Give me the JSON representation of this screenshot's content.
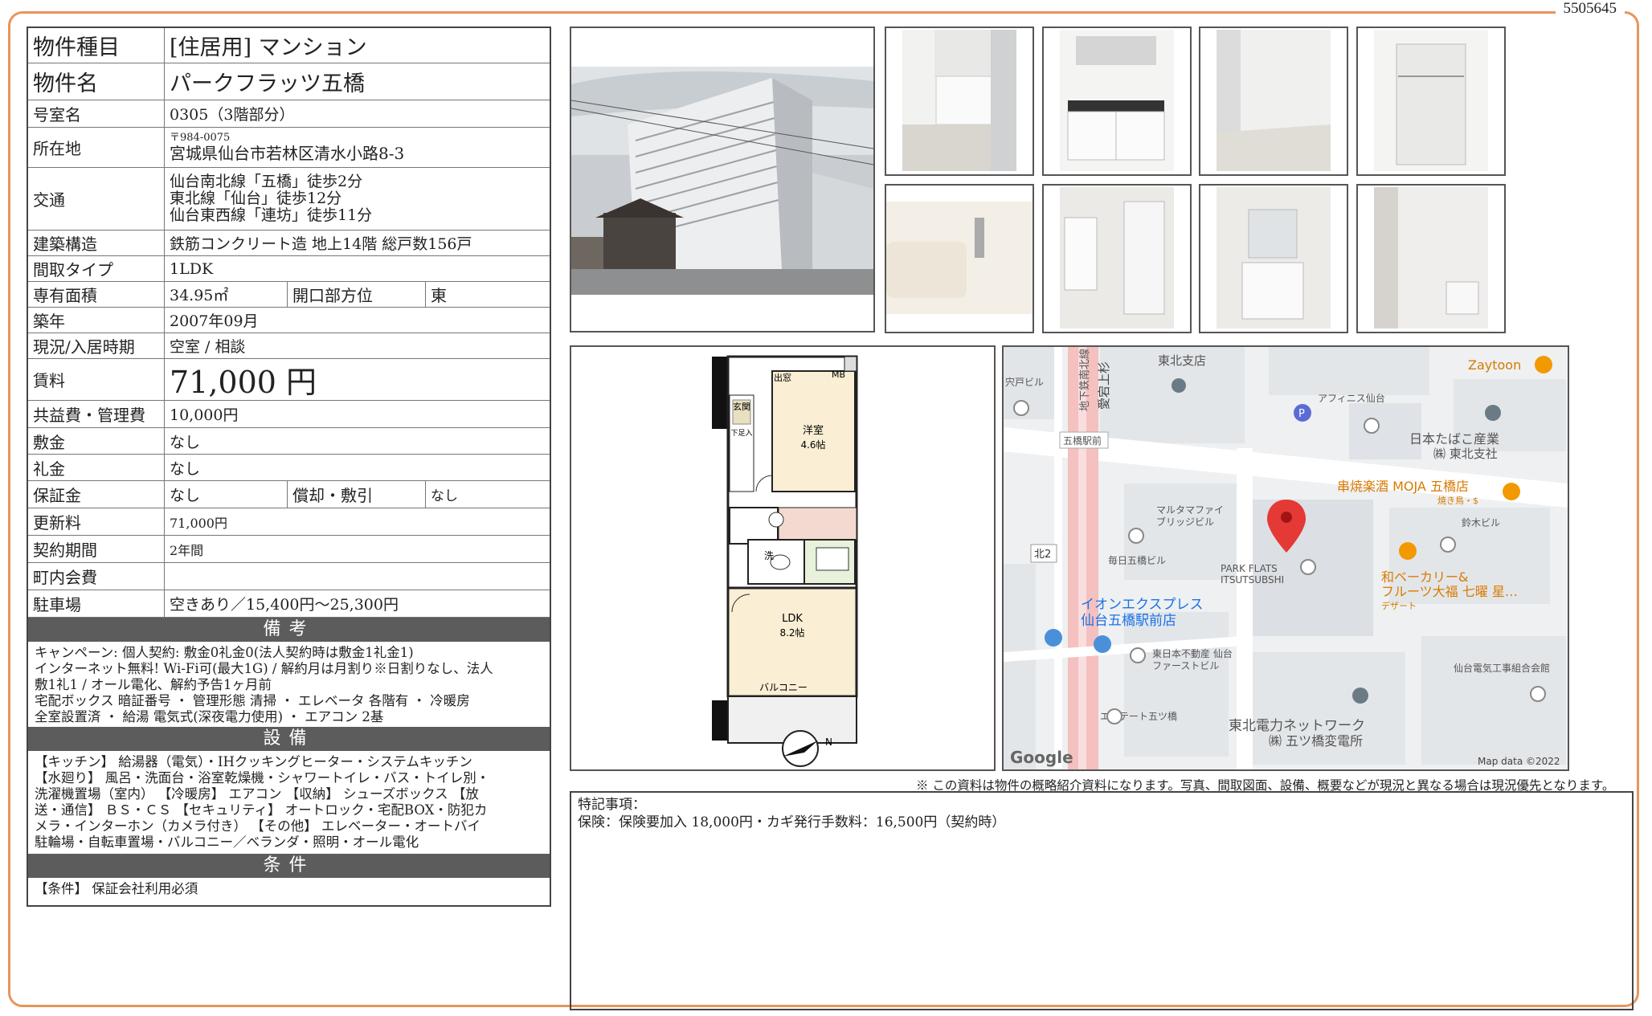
{
  "doc_id": "5505645",
  "property": {
    "type_label": "物件種目",
    "type_value": "[住居用] マンション",
    "name_label": "物件名",
    "name_value": "パークフラッツ五橋",
    "room_label": "号室名",
    "room_value": "0305（3階部分）",
    "address_label": "所在地",
    "postal": "〒984-0075",
    "address": "宮城県仙台市若林区清水小路8-3",
    "access_label": "交通",
    "access": [
      "仙台南北線「五橋」徒歩2分",
      "東北線「仙台」徒歩12分",
      "仙台東西線「連坊」徒歩11分"
    ],
    "structure_label": "建築構造",
    "structure_value": "鉄筋コンクリート造 地上14階 総戸数156戸",
    "layout_label": "間取タイプ",
    "layout_value": "1LDK",
    "area_label": "専有面積",
    "area_value": "34.95㎡",
    "facing_label": "開口部方位",
    "facing_value": "東",
    "built_label": "築年",
    "built_value": "2007年09月",
    "status_label": "現況/入居時期",
    "status_value": "空室 / 相談",
    "rent_label": "賃料",
    "rent_value": "71,000 円",
    "fee_label": "共益費・管理費",
    "fee_value": "10,000円",
    "deposit_label": "敷金",
    "deposit_value": "なし",
    "key_money_label": "礼金",
    "key_money_value": "なし",
    "guarantee_label": "保証金",
    "guarantee_value": "なし",
    "amort_label": "償却・敷引",
    "amort_value": "なし",
    "renewal_label": "更新料",
    "renewal_value": "71,000円",
    "contract_label": "契約期間",
    "contract_value": "2年間",
    "community_label": "町内会費",
    "community_value": "",
    "parking_label": "駐車場",
    "parking_value": "空きあり／15,400円〜25,300円"
  },
  "sections": {
    "remarks_title": "備考",
    "remarks_lines": [
      "キャンペーン: 個人契約: 敷金0礼金0(法人契約時は敷金1礼金1)",
      "インターネット無料! Wi-Fi可(最大1G) / 解約月は月割り※日割りなし、法人",
      "敷1礼1 / オール電化、解約予告1ヶ月前",
      "宅配ボックス 暗証番号 ・ 管理形態 清掃 ・ エレベータ 各階有 ・ 冷暖房",
      "全室設置済 ・ 給湯 電気式(深夜電力使用) ・ エアコン 2基"
    ],
    "equipment_title": "設備",
    "equipment_lines": [
      "【キッチン】 給湯器（電気）・IHクッキングヒーター・システムキッチン",
      "【水廻り】 風呂・洗面台・浴室乾燥機・シャワートイレ・バス・トイレ別・",
      "洗濯機置場（室内） 【冷暖房】 エアコン 【収納】 シューズボックス 【放",
      "送・通信】 ＢＳ・ＣＳ 【セキュリティ】 オートロック・宅配BOX・防犯カ",
      "メラ・インターホン（カメラ付き） 【その他】 エレベーター・オートバイ",
      "駐輪場・自転車置場・バルコニー／ベランダ・照明・オール電化"
    ],
    "conditions_title": "条件",
    "conditions_lines": [
      "【条件】 保証会社利用必須"
    ]
  },
  "floorplan": {
    "entrance": "玄関",
    "closet_top": "出窓",
    "mb": "MB",
    "storage": "下足入",
    "western_room": "洋室",
    "western_size": "4.6帖",
    "wash": "洗",
    "ldk": "LDK",
    "ldk_size": "8.2帖",
    "balcony": "バルコニー",
    "north": "N"
  },
  "map": {
    "labels": {
      "tohoku_branch": "東北支店",
      "shido_bldg": "宍戸ビル",
      "line_label": "地下鉄南北線",
      "street_label": "愛宕上杉",
      "zaytoon": "Zaytoon",
      "afinis": "アフィニス仙台",
      "japan_tobacco": "日本たばこ産業",
      "jt_branch": "㈱ 東北支社",
      "goban_station": "五橋駅前",
      "kushiyaki": "串焼楽酒 MOJA 五橋店",
      "kushiyaki_sub": "焼き鳥・$",
      "marutama": "マルタマファイ",
      "marutama2": "ブリッジビル",
      "suzuki": "鈴木ビル",
      "north2": "北2",
      "mainichi": "毎日五橋ビル",
      "park_flats": "PARK FLATS",
      "park_flats2": "ITSUTSUBSHI",
      "bakery": "和ベーカリー&",
      "bakery2": "フルーツ大福 七曜 星…",
      "dessert": "デザート",
      "aeon": "イオンエクスプレス",
      "aeon2": "仙台五橋駅前店",
      "higashi": "東日本不動産 仙台",
      "higashi2": "ファーストビル",
      "denki_union": "仙台電気工事組合会館",
      "estate": "エステート五ツ橋",
      "tohoku_power": "東北電力ネットワーク",
      "substation": "㈱ 五ツ橋変電所",
      "google": "Google",
      "map_data": "Map data ©2022"
    }
  },
  "disclaimer": "※ この資料は物件の概略紹介資料になります。写真、間取図面、設備、概要などが現況と異なる場合は現況優先となります。",
  "special": {
    "title": "特記事項：",
    "text": "保険：保険要加入 18,000円・カギ発行手数料：16,500円（契約時）"
  },
  "colors": {
    "frame": "#e8955a",
    "section_header": "#5c5c5c",
    "pin_red": "#e53935",
    "rail": "#f3b3b3"
  }
}
